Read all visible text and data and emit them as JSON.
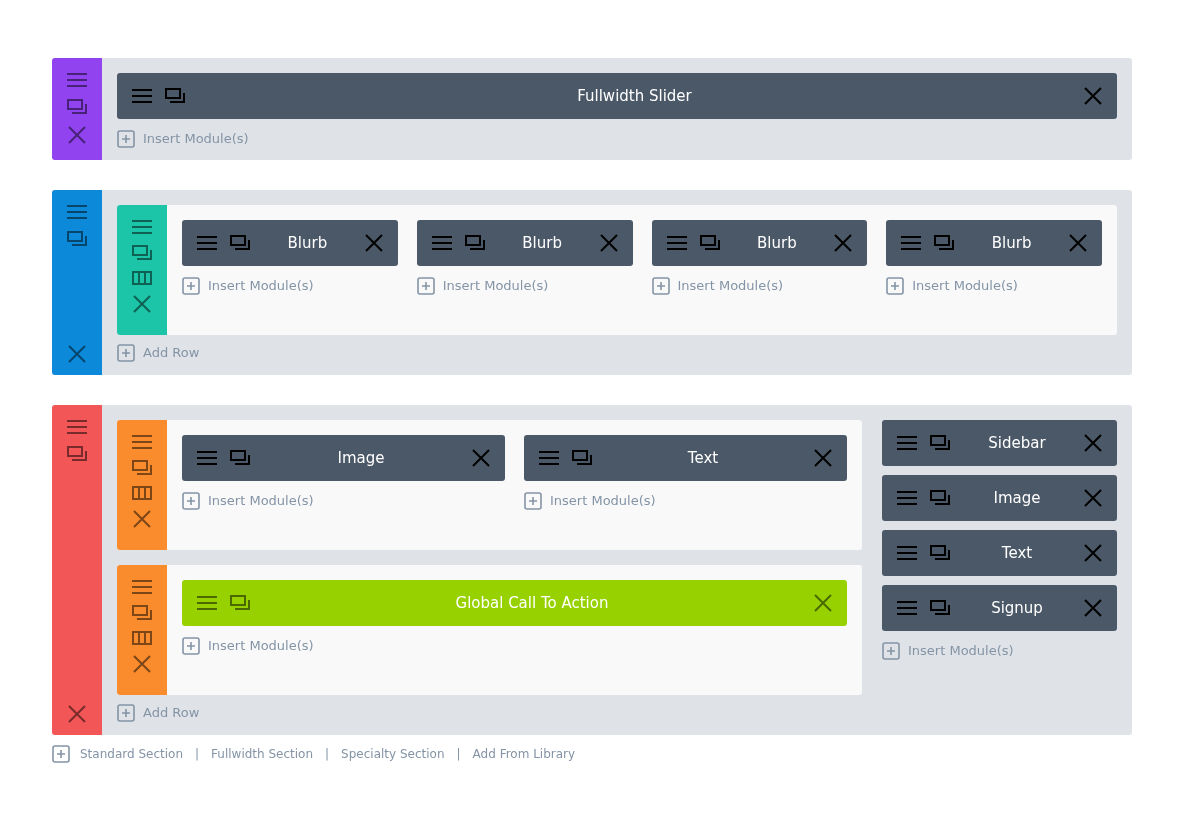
{
  "sections": [
    {
      "kind": "fullwidth",
      "color": "#9143f0",
      "modules": [
        {
          "kind": "standard",
          "label": "Fullwidth Slider"
        }
      ],
      "insert_label": "Insert Module(s)"
    },
    {
      "kind": "regular",
      "color": "#0c8ad9",
      "rows": [
        {
          "color": "#1dc5a8",
          "columns": [
            {
              "modules": [
                {
                  "kind": "standard",
                  "label": "Blurb"
                }
              ],
              "insert_label": "Insert Module(s)"
            },
            {
              "modules": [
                {
                  "kind": "standard",
                  "label": "Blurb"
                }
              ],
              "insert_label": "Insert Module(s)"
            },
            {
              "modules": [
                {
                  "kind": "standard",
                  "label": "Blurb"
                }
              ],
              "insert_label": "Insert Module(s)"
            },
            {
              "modules": [
                {
                  "kind": "standard",
                  "label": "Blurb"
                }
              ],
              "insert_label": "Insert Module(s)"
            }
          ]
        }
      ],
      "add_row_label": "Add Row"
    },
    {
      "kind": "specialty",
      "color": "#f25656",
      "rows": [
        {
          "color": "#fb8c2e",
          "columns": [
            {
              "modules": [
                {
                  "kind": "standard",
                  "label": "Image"
                }
              ],
              "insert_label": "Insert Module(s)"
            },
            {
              "modules": [
                {
                  "kind": "standard",
                  "label": "Text"
                }
              ],
              "insert_label": "Insert Module(s)"
            }
          ]
        },
        {
          "color": "#fb8c2e",
          "columns": [
            {
              "modules": [
                {
                  "kind": "global",
                  "label": "Global Call To Action"
                }
              ],
              "insert_label": "Insert Module(s)"
            }
          ]
        }
      ],
      "add_row_label": "Add Row",
      "side_column": {
        "modules": [
          {
            "kind": "standard",
            "label": "Sidebar"
          },
          {
            "kind": "standard",
            "label": "Image"
          },
          {
            "kind": "standard",
            "label": "Text"
          },
          {
            "kind": "standard",
            "label": "Signup"
          }
        ],
        "insert_label": "Insert Module(s)"
      }
    }
  ],
  "footer": {
    "items": [
      {
        "kind": "link",
        "label": "Standard Section"
      },
      {
        "kind": "separator",
        "label": "|"
      },
      {
        "kind": "link",
        "label": "Fullwidth Section"
      },
      {
        "kind": "separator",
        "label": "|"
      },
      {
        "kind": "link",
        "label": "Specialty Section"
      },
      {
        "kind": "separator",
        "label": "|"
      },
      {
        "kind": "link",
        "label": "Add From Library"
      }
    ]
  }
}
